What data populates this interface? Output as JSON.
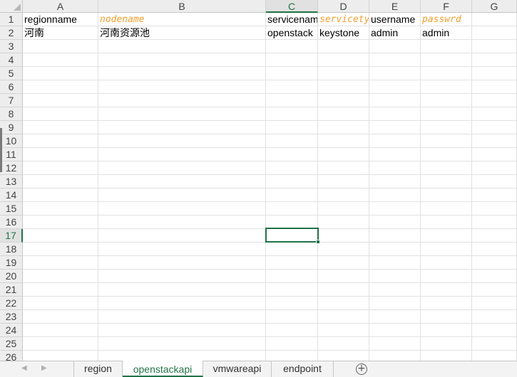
{
  "columns": [
    "A",
    "B",
    "C",
    "D",
    "E",
    "F",
    "G"
  ],
  "active_column": "C",
  "rows": [
    "1",
    "2",
    "3",
    "4",
    "5",
    "6",
    "7",
    "8",
    "9",
    "10",
    "11",
    "12",
    "13",
    "14",
    "15",
    "16",
    "17",
    "18",
    "19",
    "20",
    "21",
    "22",
    "23",
    "24",
    "25",
    "26"
  ],
  "active_row": "17",
  "cells": {
    "r1": {
      "a": "regionname",
      "b": "nodename",
      "c": "servicenam",
      "d": "servicety",
      "e": "username",
      "f": "passwrd",
      "g": ""
    },
    "r2": {
      "a": "河南",
      "b": "河南资源池",
      "c": "openstack",
      "d": "keystone",
      "e": "admin",
      "f": "admin",
      "g": ""
    }
  },
  "header_highlight_color": "#f0a030",
  "accent_color": "#217346",
  "sheet_tabs": {
    "prev_icon": "◀",
    "next_icon": "▶",
    "items": [
      "region",
      "openstackapi",
      "vmwareapi",
      "endpoint"
    ],
    "active": "openstackapi",
    "add_icon": "+"
  }
}
